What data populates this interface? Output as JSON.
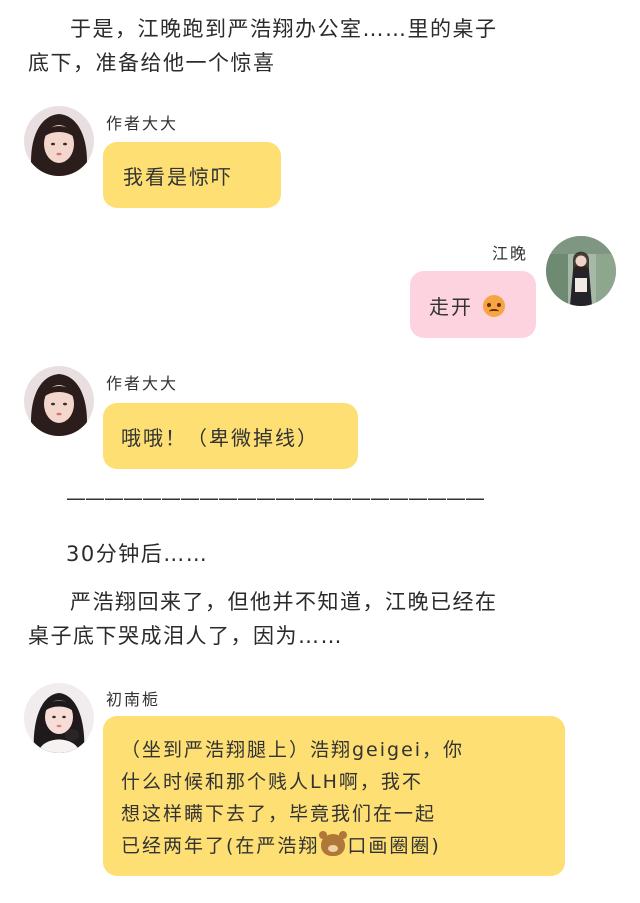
{
  "narration_1": {
    "line1": "于是，江晚跑到严浩翔办公室……里的桌子",
    "line2": "底下，准备给他一个惊喜"
  },
  "msg1": {
    "sender": "作者大大",
    "text": "我看是惊吓"
  },
  "msg2": {
    "sender": "江晚",
    "text": "走开"
  },
  "msg3": {
    "sender": "作者大大",
    "text": "哦哦！（卑微掉线）"
  },
  "divider": "——————————————————————",
  "narration_2": "30分钟后……",
  "narration_3": {
    "line1": "严浩翔回来了，但他并不知道，江晚已经在",
    "line2": "桌子底下哭成泪人了，因为……"
  },
  "msg4": {
    "sender": "初南栀",
    "line1": "（坐到严浩翔腿上）浩翔geigei，你",
    "line2": "什么时候和那个贱人LH啊，我不",
    "line3": "想这样瞒下去了，毕竟我们在一起",
    "line4a": "已经两年了(在严浩翔",
    "line4b": "口画圈圈)"
  },
  "icons": {
    "angry": "angry-face-emoji",
    "bear": "bear-face-emoji"
  },
  "colors": {
    "yellow_bubble": "#fddf74",
    "pink_bubble": "#fcd3df"
  }
}
